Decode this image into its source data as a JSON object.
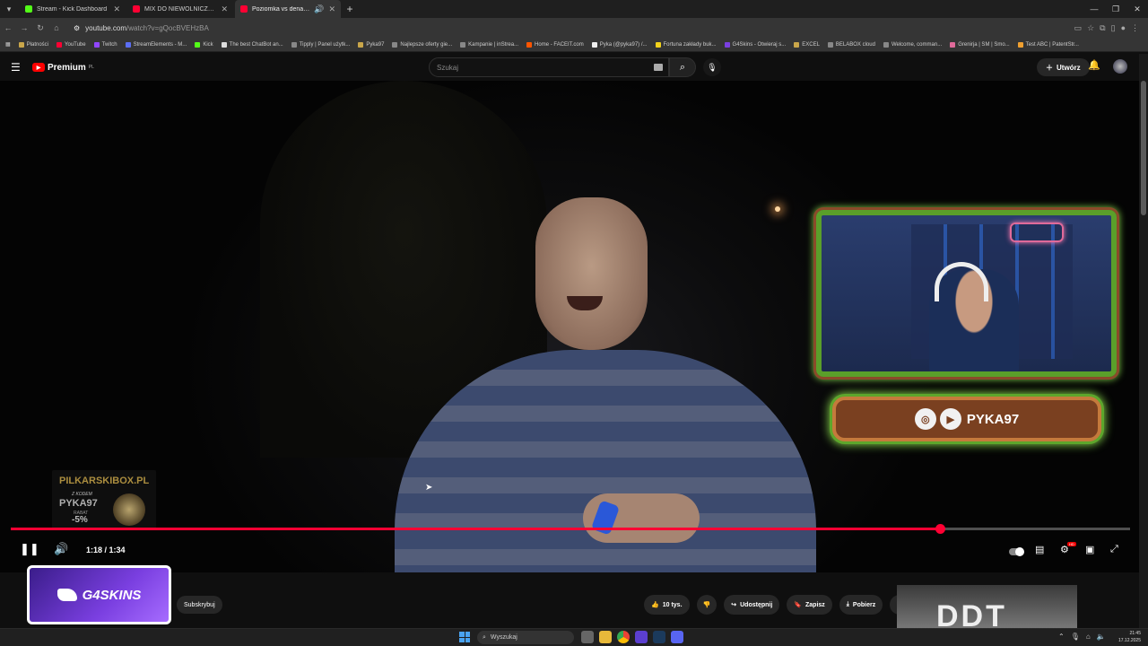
{
  "browser": {
    "tabs": [
      {
        "title": "Stream - Kick Dashboard",
        "color": "#53fc18",
        "active": false
      },
      {
        "title": "MIX DO NIEWOLNICZEJ PRACY",
        "color": "#ff0033",
        "active": false
      },
      {
        "title": "Poziomka vs denaturat - Yo",
        "color": "#ff0033",
        "active": true
      }
    ],
    "new_tab": "+",
    "url_site": "youtube.com",
    "url_path": "/watch?v=gQocBVEHzBA",
    "bookmarks": [
      "Płatności",
      "YouTube",
      "Twitch",
      "StreamElements - M...",
      "Kick",
      "The best ChatBot an...",
      "Tipply | Panel użytk...",
      "Pyka97",
      "Najlepsze oferty gie...",
      "Kampanie | inStrea...",
      "Home - FACEIT.com",
      "Pyka (@pyka97) /...",
      "Fortuna zakłady buk...",
      "G4Skins - Otwieraj s...",
      "EXCEL",
      "BELABOX cloud",
      "Welcome, comman...",
      "Grenirja | SM | Smo...",
      "Test ABC | PatentStr..."
    ]
  },
  "youtube": {
    "logo_text": "Premium",
    "logo_region": "PL",
    "search_placeholder": "Szukaj",
    "create_label": "Utwórz"
  },
  "overlay": {
    "social_handle": "PYKA97",
    "promo_site": "PILKARSKIBOX.PL",
    "promo_code_label": "Z KODEM",
    "promo_code": "PYKA97",
    "promo_discount_label": "RABAT",
    "promo_discount": "-5%",
    "sponsor": "G4SKINS"
  },
  "player": {
    "time_current": "1:18",
    "time_total": "1:34",
    "time_display": "1:18 / 1:34",
    "progress": 0.83
  },
  "below_video": {
    "subscribe_label": "Subskrybuj",
    "likes_label": "10 tys.",
    "share_label": "Udostępnij",
    "save_label": "Zapisz",
    "download_label": "Pobierz",
    "next_thumb_text": "DDT"
  },
  "taskbar": {
    "search_label": "Wyszukaj",
    "time": "21:45",
    "date": "17.12.2025"
  }
}
